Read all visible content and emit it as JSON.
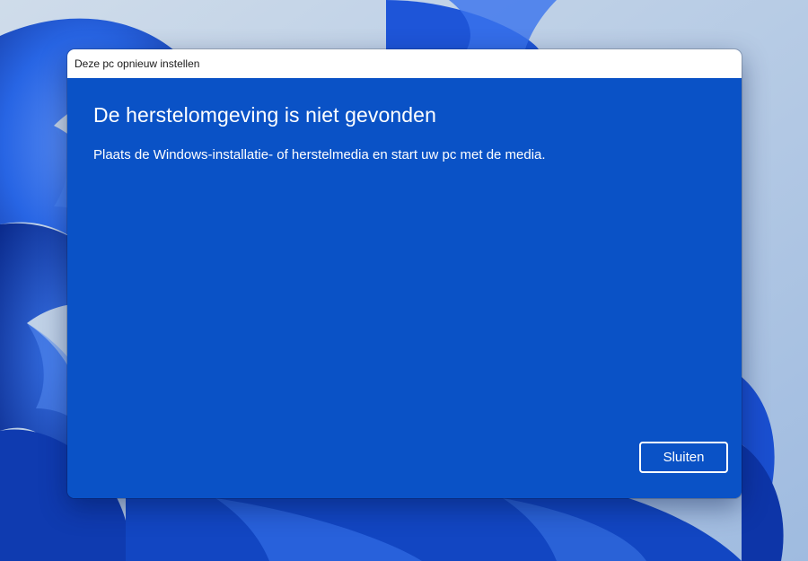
{
  "dialog": {
    "title": "Deze pc opnieuw instellen",
    "heading": "De herstelomgeving is niet gevonden",
    "message": "Plaats de Windows-installatie- of herstelmedia en start uw pc met de media.",
    "close_label": "Sluiten"
  },
  "colors": {
    "dialog_background": "#0a52c6",
    "titlebar_background": "#ffffff",
    "text": "#ffffff",
    "wallpaper_base": "#b9cde4",
    "wallpaper_bloom": "#1e5be0"
  }
}
